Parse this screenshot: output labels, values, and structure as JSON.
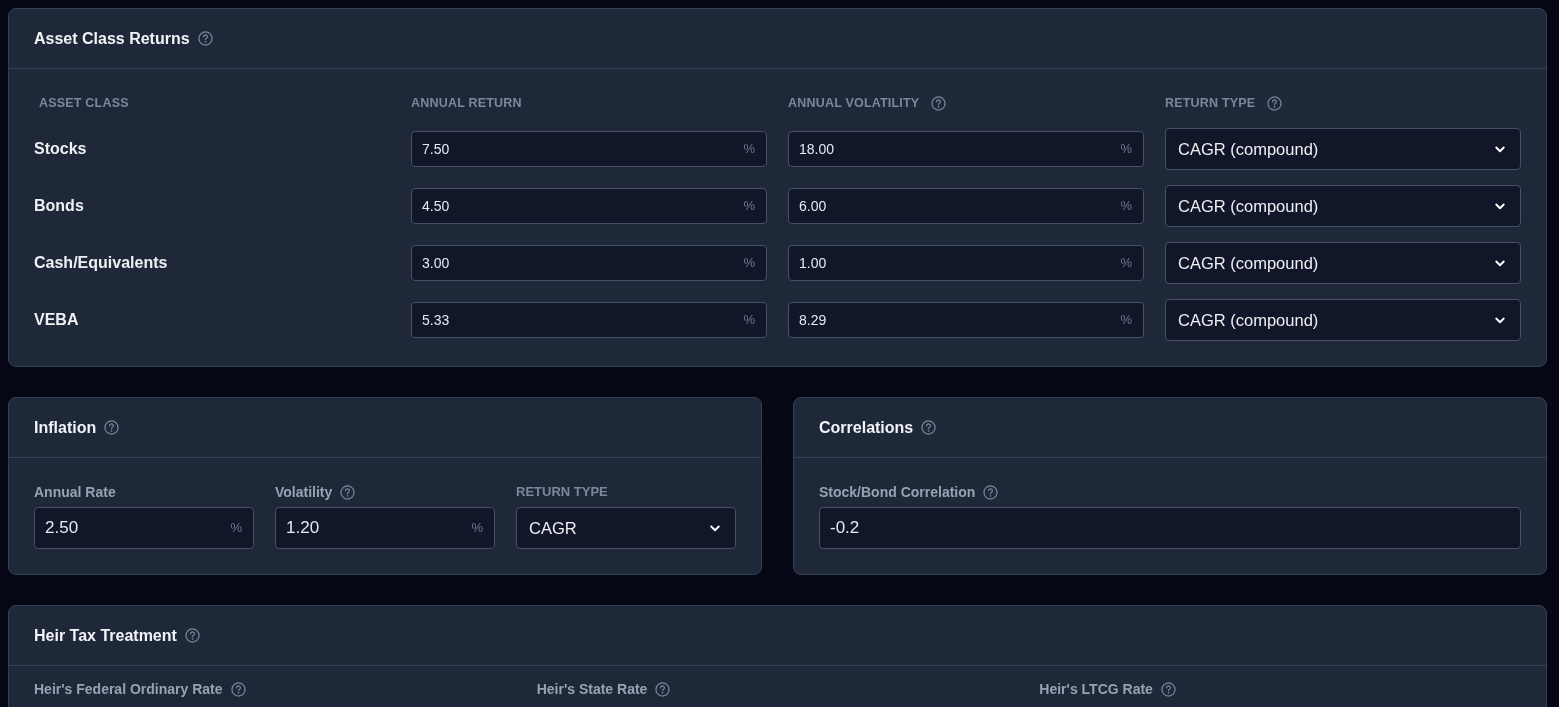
{
  "asset_class_returns": {
    "title": "Asset Class Returns",
    "columns": [
      {
        "label": "ASSET CLASS",
        "help": false
      },
      {
        "label": "ANNUAL RETURN",
        "help": false
      },
      {
        "label": "ANNUAL VOLATILITY",
        "help": true
      },
      {
        "label": "RETURN TYPE",
        "help": true
      }
    ],
    "rows": [
      {
        "name": "Stocks",
        "annual_return": "7.50",
        "return_unit": "%",
        "annual_volatility": "18.00",
        "volatility_unit": "%",
        "return_type": "CAGR (compound)"
      },
      {
        "name": "Bonds",
        "annual_return": "4.50",
        "return_unit": "%",
        "annual_volatility": "6.00",
        "volatility_unit": "%",
        "return_type": "CAGR (compound)"
      },
      {
        "name": "Cash/Equivalents",
        "annual_return": "3.00",
        "return_unit": "%",
        "annual_volatility": "1.00",
        "volatility_unit": "%",
        "return_type": "CAGR (compound)"
      },
      {
        "name": "VEBA",
        "annual_return": "5.33",
        "return_unit": "%",
        "annual_volatility": "8.29",
        "volatility_unit": "%",
        "return_type": "CAGR (compound)"
      }
    ]
  },
  "inflation": {
    "title": "Inflation",
    "fields": [
      {
        "kind": "percent",
        "label": "Annual Rate",
        "help": false,
        "value": "2.50",
        "unit": "%"
      },
      {
        "kind": "percent",
        "label": "Volatility",
        "help": true,
        "value": "1.20",
        "unit": "%"
      },
      {
        "kind": "select",
        "label": "RETURN TYPE",
        "help": false,
        "value": "CAGR"
      }
    ]
  },
  "correlations": {
    "title": "Correlations",
    "fields": [
      {
        "kind": "text",
        "label": "Stock/Bond Correlation",
        "help": true,
        "value": "-0.2"
      }
    ]
  },
  "heir_tax_treatment": {
    "title": "Heir Tax Treatment",
    "fields": [
      {
        "label": "Heir's Federal Ordinary Rate",
        "help": true
      },
      {
        "label": "Heir's State Rate",
        "help": true
      },
      {
        "label": "Heir's LTCG Rate",
        "help": true
      }
    ]
  }
}
